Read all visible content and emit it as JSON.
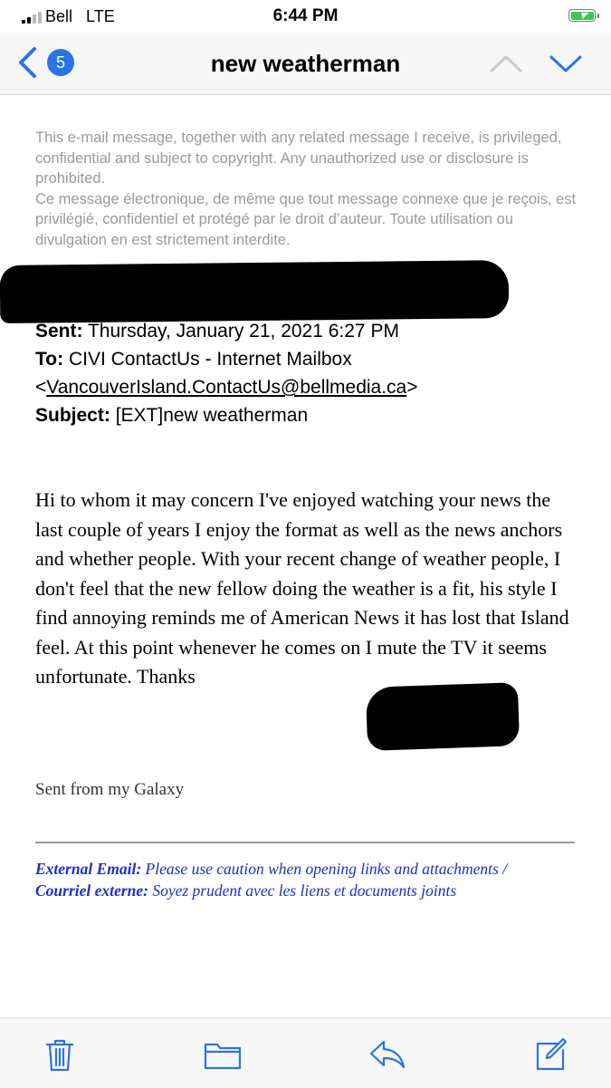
{
  "status_bar": {
    "carrier": "Bell",
    "network": "LTE",
    "time": "6:44 PM",
    "battery_state": "charging",
    "accent": "#3cc852"
  },
  "nav": {
    "unread_count": "5",
    "title": "new weatherman",
    "accent": "#2a74e3"
  },
  "disclaimer": {
    "english": "This e-mail message, together with any related message I receive, is privileged, confidential and subject to copyright. Any unauthorized use or disclosure is prohibited.",
    "french": "Ce message électronique, de même que tout message connexe que je reçois, est privilégié, confidentiel et protégé par le droit d’auteur. Toute utilisation ou divulgation en est strictement interdite."
  },
  "headers": {
    "sent_label": "Sent:",
    "sent_value": "Thursday, January 21, 2021 6:27 PM",
    "to_label": "To:",
    "to_name": "CIVI ContactUs - Internet Mailbox",
    "to_open": "<",
    "to_email": "VancouverIsland.ContactUs@bellmedia.ca",
    "to_close": ">",
    "subject_label": "Subject:",
    "subject_value": "[EXT]new weatherman"
  },
  "body": {
    "message": "Hi to whom it may concern I've enjoyed watching your news the last couple of years I enjoy the format as well as the news anchors and whether people. With your recent change of weather people, I don't feel that the new fellow doing the weather is a fit, his style I find annoying reminds me of American News it has lost that Island feel. At this point whenever he comes on I mute the TV it seems unfortunate. Thanks",
    "signature": "Sent from my Galaxy"
  },
  "external_notice": {
    "en_label": "External Email:",
    "en_text": "Please use caution when opening links and attachments /",
    "fr_label": "Courriel externe:",
    "fr_text": "Soyez prudent avec les liens et documents joints",
    "color": "#1c2fc7"
  },
  "toolbar": {
    "icons": [
      "trash-icon",
      "folder-icon",
      "reply-icon",
      "compose-icon"
    ],
    "icon_color": "#2a74e3"
  }
}
